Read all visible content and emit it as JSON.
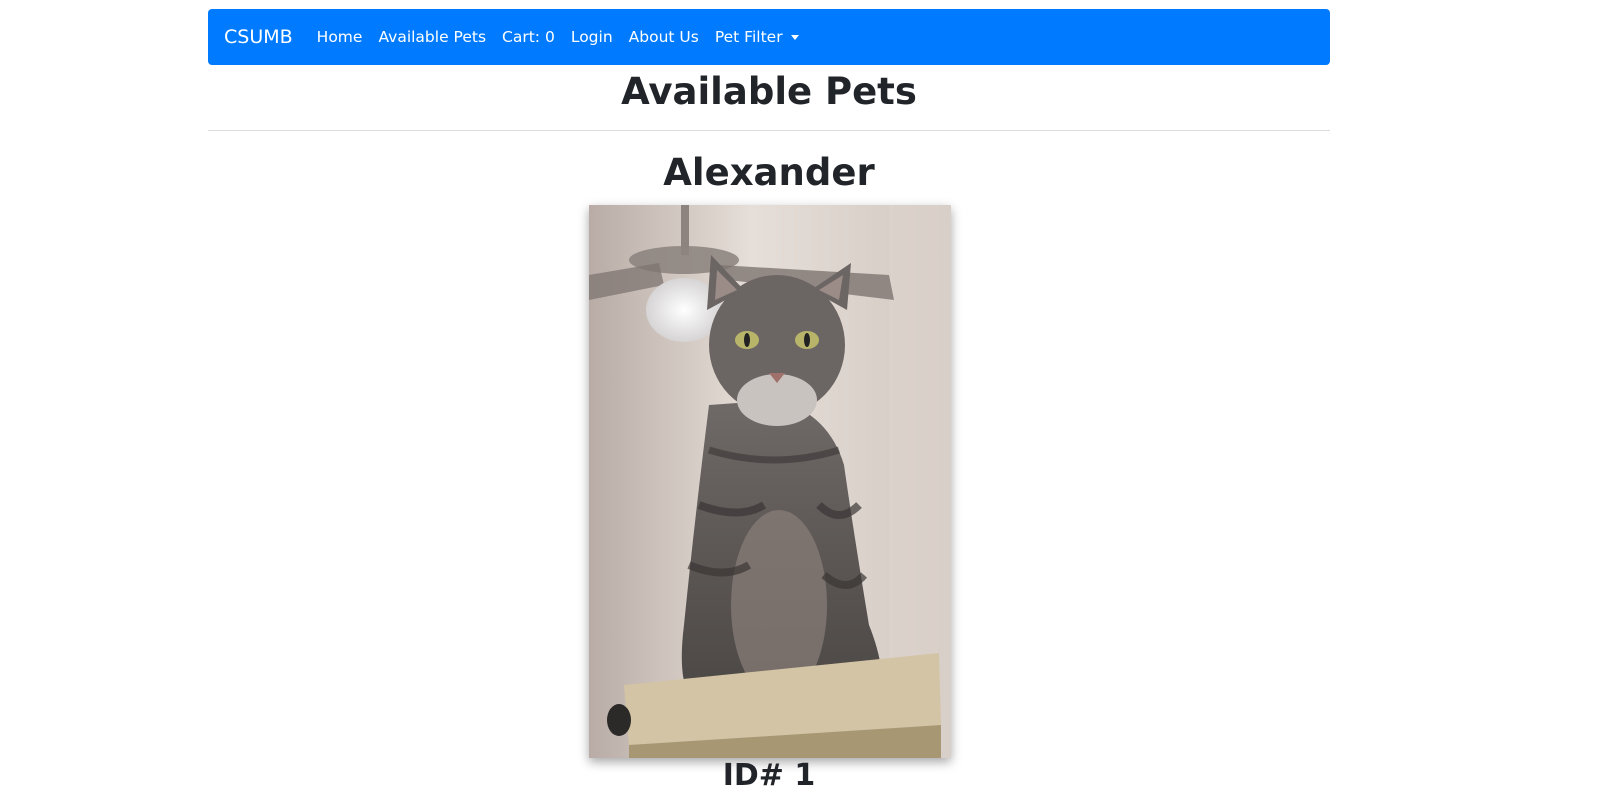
{
  "navbar": {
    "brand": "CSUMB",
    "links": [
      {
        "label": "Home"
      },
      {
        "label": "Available Pets"
      },
      {
        "label": "Cart: 0"
      },
      {
        "label": "Login"
      },
      {
        "label": "About Us"
      }
    ],
    "dropdown_label": "Pet Filter",
    "background_color": "#007bff"
  },
  "main": {
    "page_title": "Available Pets",
    "pets": [
      {
        "name": "Alexander",
        "id_text": "ID# 1"
      }
    ]
  }
}
